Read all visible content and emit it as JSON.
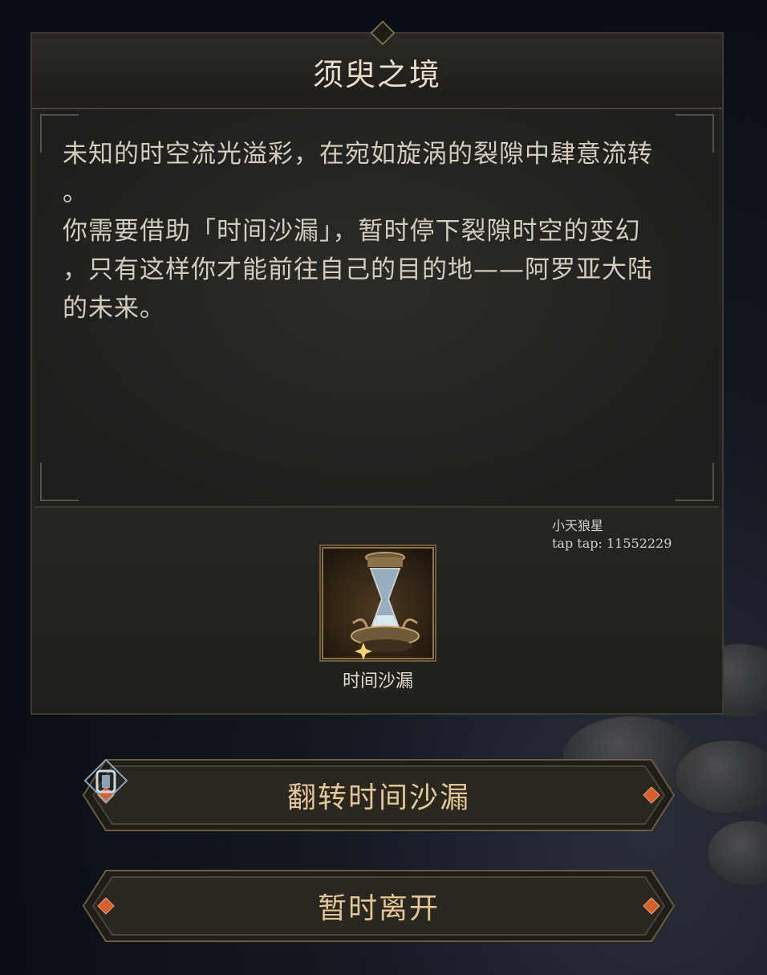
{
  "dialog": {
    "title": "须臾之境",
    "description": [
      "未知的时空流光溢彩，在宛如旋涡的裂隙中肆意流转",
      "。",
      "你需要借助「时间沙漏」，暂时停下裂隙时空的变幻",
      "，只有这样你才能前往自己的目的地——阿罗亚大陆",
      "的未来。"
    ]
  },
  "reward": {
    "item_label": "时间沙漏",
    "item_icon": "hourglass-icon"
  },
  "watermark": {
    "line1": "小天狼星",
    "line2": "tap tap: 11552229"
  },
  "actions": {
    "flip_label": "翻转时间沙漏",
    "leave_label": "暂时离开"
  },
  "colors": {
    "panel_bg": "#22221f",
    "button_text": "#e0c694",
    "accent_gem": "#d4602e"
  }
}
